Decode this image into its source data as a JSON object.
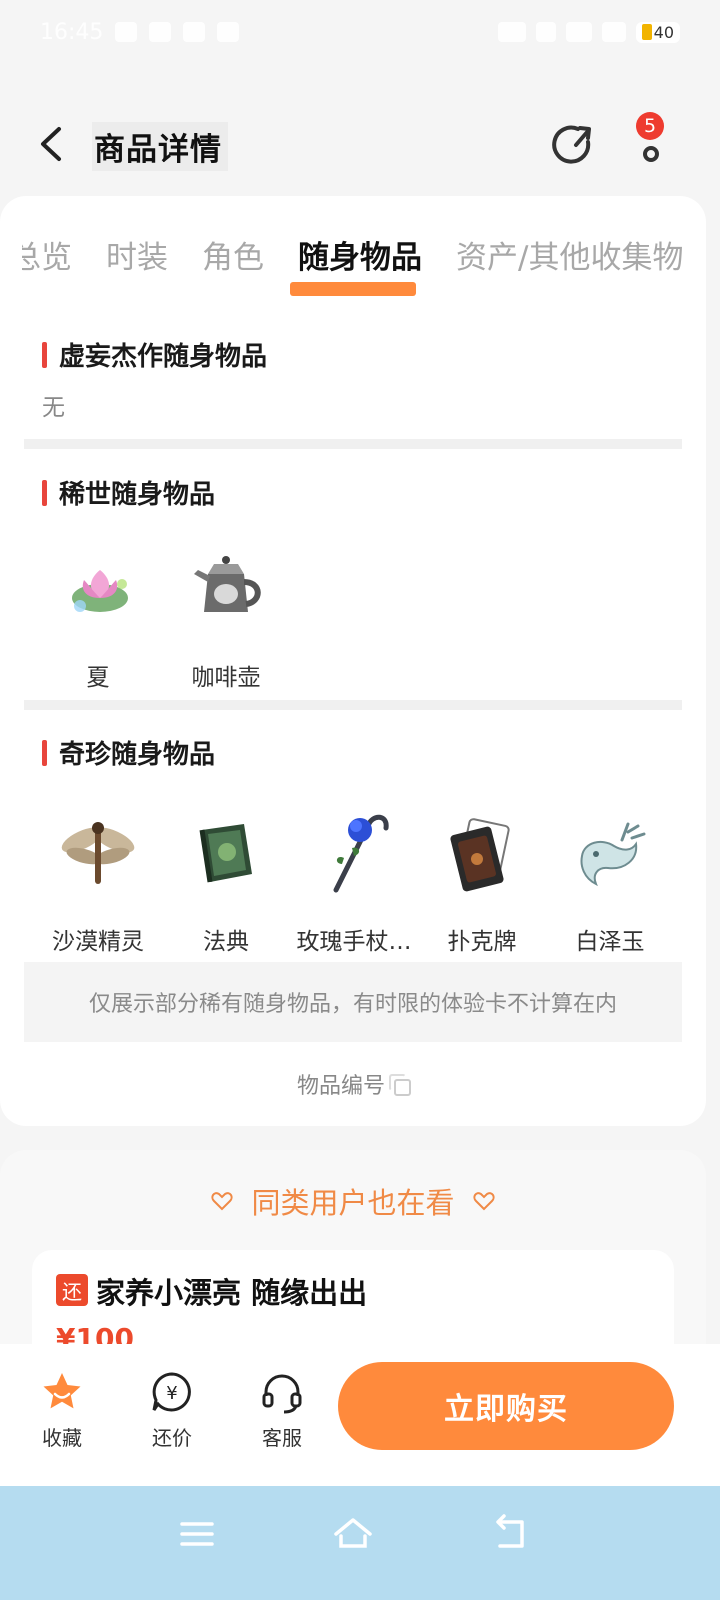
{
  "status_bar": {
    "time": "16:45",
    "battery": "40"
  },
  "header": {
    "title": "商品详情",
    "badge_count": "5"
  },
  "tabs": [
    {
      "label": "总览",
      "active": false
    },
    {
      "label": "时装",
      "active": false
    },
    {
      "label": "角色",
      "active": false
    },
    {
      "label": "随身物品",
      "active": true
    },
    {
      "label": "资产/其他收集物",
      "active": false
    }
  ],
  "sections": {
    "masterpiece": {
      "title": "虚妄杰作随身物品",
      "empty_text": "无"
    },
    "rare": {
      "title": "稀世随身物品",
      "items": [
        {
          "label": "夏",
          "icon": "lotus-icon"
        },
        {
          "label": "咖啡壶",
          "icon": "coffee-pot-icon"
        }
      ]
    },
    "treasure": {
      "title": "奇珍随身物品",
      "items": [
        {
          "label": "沙漠精灵",
          "icon": "dragonfly-icon"
        },
        {
          "label": "法典",
          "icon": "book-icon"
        },
        {
          "label": "玫瑰手杖…",
          "icon": "rose-cane-icon"
        },
        {
          "label": "扑克牌",
          "icon": "playing-card-icon"
        },
        {
          "label": "白泽玉",
          "icon": "jade-deer-icon"
        }
      ]
    }
  },
  "note": "仅展示部分稀有随身物品，有时限的体验卡不计算在内",
  "item_number_label": "物品编号",
  "recommend": {
    "title": "同类用户也在看",
    "item": {
      "tag": "还",
      "name": "家养小漂亮 随缘出出",
      "price": "¥100"
    }
  },
  "actions": {
    "favorite": "收藏",
    "bargain": "还价",
    "service": "客服",
    "buy": "立即购买"
  },
  "colors": {
    "accent": "#ff8a3c",
    "section_bar": "#e8453c",
    "badge": "#ee3b2f",
    "nav_bg": "#b5dcf0"
  }
}
